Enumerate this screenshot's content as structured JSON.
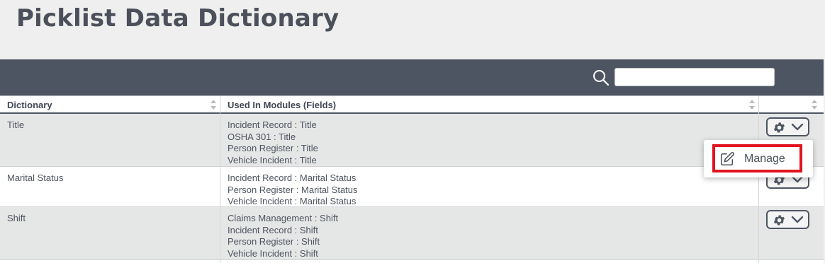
{
  "page": {
    "title": "Picklist Data Dictionary"
  },
  "search": {
    "icon": "search-icon",
    "value": ""
  },
  "table": {
    "columns": [
      {
        "label": "Dictionary"
      },
      {
        "label": "Used In Modules (Fields)"
      },
      {
        "label": ""
      }
    ],
    "rows": [
      {
        "dictionary": "Title",
        "modules": [
          "Incident Record : Title",
          "OSHA 301 : Title",
          "Person Register : Title",
          "Vehicle Incident : Title"
        ]
      },
      {
        "dictionary": "Marital Status",
        "modules": [
          "Incident Record : Marital Status",
          "Person Register : Marital Status",
          "Vehicle Incident : Marital Status"
        ]
      },
      {
        "dictionary": "Shift",
        "modules": [
          "Claims Management : Shift",
          "Incident Record : Shift",
          "Person Register : Shift",
          "Vehicle Incident : Shift"
        ]
      }
    ]
  },
  "row_actions": {
    "icon": "gear-icon",
    "menu_icon": "chevron-down-icon"
  },
  "dropdown": {
    "manage_label": "Manage",
    "manage_icon": "edit-icon",
    "highlight_color": "#e0141f"
  },
  "colors": {
    "toolbar": "#4e5562",
    "alt_row": "#e5e6e6",
    "title": "#4b505a"
  }
}
